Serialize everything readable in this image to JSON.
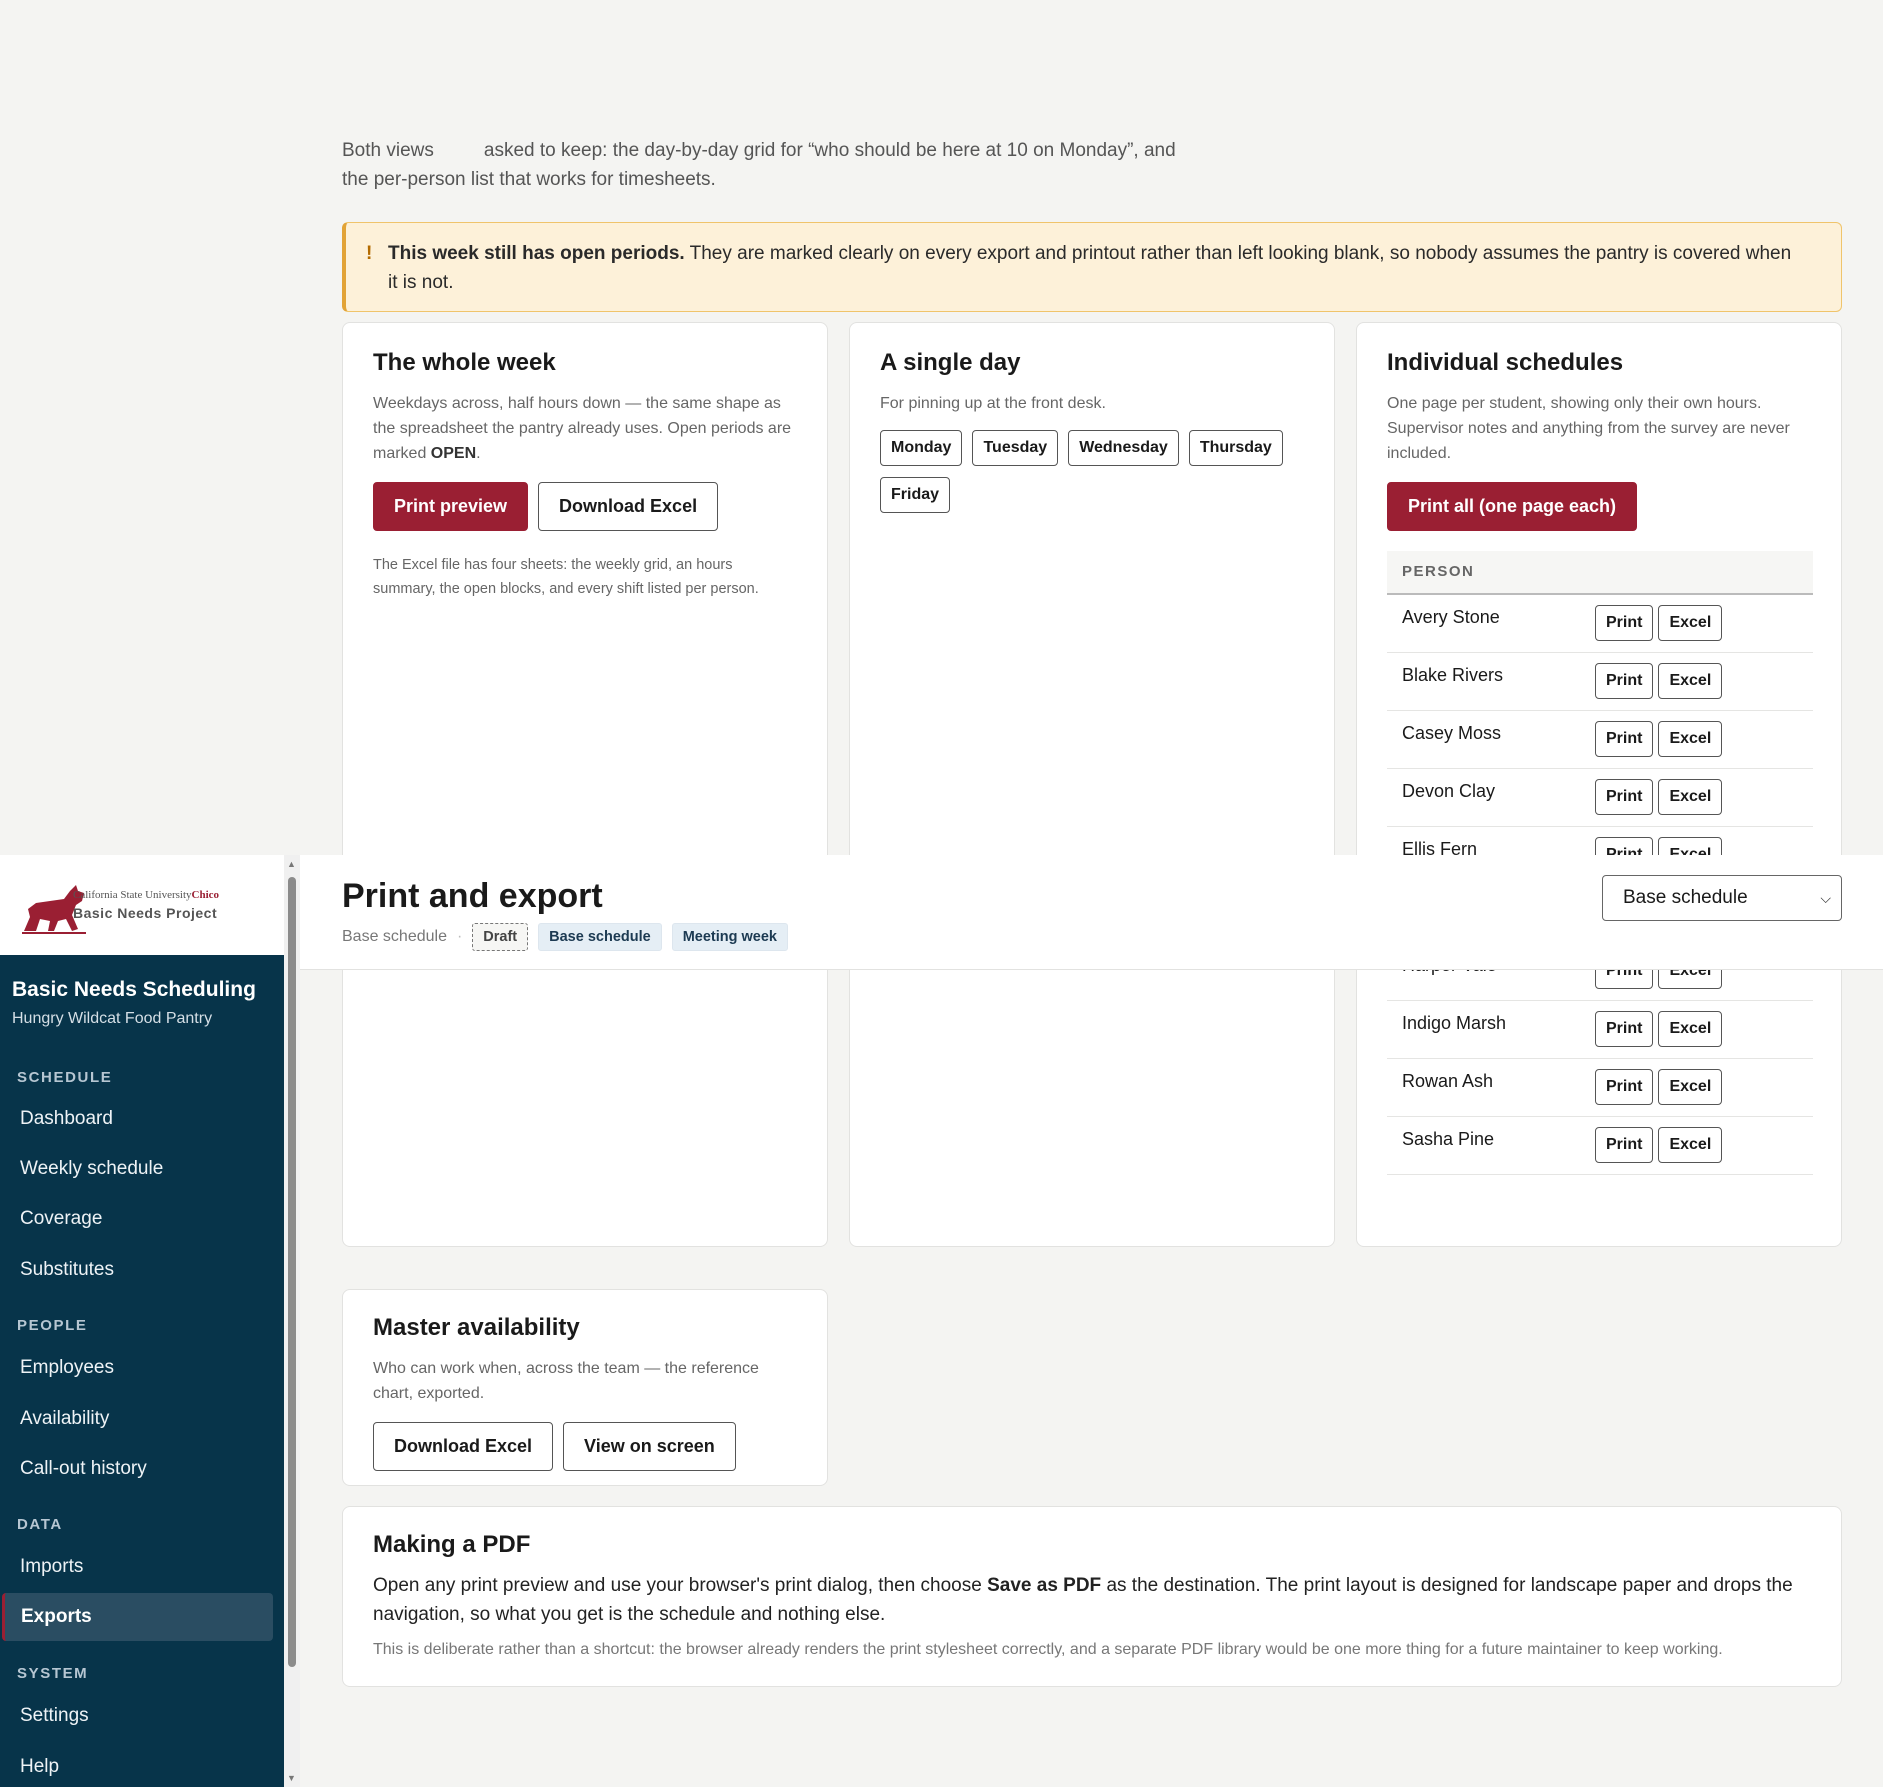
{
  "intro": {
    "part1": "Both views",
    "part2": "asked to keep: the day-by-day grid for “who should be here at 10 on Monday”, and the per-person list that works for timesheets."
  },
  "alert": {
    "icon": "!",
    "bold": "This week still has open periods.",
    "text": " They are marked clearly on every export and printout rather than left looking blank, so nobody assumes the pantry is covered when it is not."
  },
  "whole_week": {
    "title": "The whole week",
    "desc_before": "Weekdays across, half hours down — the same shape as the spreadsheet the pantry already uses. Open periods are marked ",
    "desc_bold": "OPEN",
    "desc_after": ".",
    "print_label": "Print preview",
    "excel_label": "Download Excel",
    "note": "The Excel file has four sheets: the weekly grid, an hours summary, the open blocks, and every shift listed per person."
  },
  "single_day": {
    "title": "A single day",
    "desc": "For pinning up at the front desk.",
    "days": [
      "Monday",
      "Tuesday",
      "Wednesday",
      "Thursday",
      "Friday"
    ]
  },
  "individual": {
    "title": "Individual schedules",
    "desc": "One page per student, showing only their own hours. Supervisor notes and anything from the survey are never included.",
    "print_all_label": "Print all (one page each)",
    "column_header": "PERSON",
    "print_label": "Print",
    "excel_label": "Excel",
    "people": [
      "Avery Stone",
      "Blake Rivers",
      "Casey Moss",
      "Devon Clay",
      "Ellis Fern",
      "",
      "Harper Vale",
      "Indigo Marsh",
      "Rowan Ash",
      "Sasha Pine"
    ]
  },
  "master": {
    "title": "Master availability",
    "desc": "Who can work when, across the team — the reference chart, exported.",
    "excel_label": "Download Excel",
    "view_label": "View on screen"
  },
  "pdf": {
    "title": "Making a PDF",
    "body_before": "Open any print preview and use your browser's print dialog, then choose ",
    "body_bold": "Save as PDF",
    "body_after": " as the destination. The print layout is designed for landscape paper and drops the navigation, so what you get is the schedule and nothing else.",
    "fine": "This is deliberate rather than a shortcut: the browser already renders the print stylesheet correctly, and a separate PDF library would be one more thing for a future maintainer to keep working."
  },
  "header": {
    "title": "Print and export",
    "schedule_name": "Base schedule",
    "separator": "·",
    "badges": [
      "Draft",
      "Base schedule",
      "Meeting week"
    ],
    "select_value": "Base schedule"
  },
  "logo": {
    "line1_prefix": "California State University",
    "line1_brand": "Chico",
    "line2": "Basic Needs Project"
  },
  "sidebar": {
    "app_title": "Basic Needs Scheduling",
    "app_subtitle": "Hungry Wildcat Food Pantry",
    "sections": {
      "schedule": "SCHEDULE",
      "people": "PEOPLE",
      "data": "DATA",
      "system": "SYSTEM"
    },
    "items": {
      "dashboard": "Dashboard",
      "weekly": "Weekly schedule",
      "coverage": "Coverage",
      "substitutes": "Substitutes",
      "employees": "Employees",
      "availability": "Availability",
      "callout": "Call-out history",
      "imports": "Imports",
      "exports": "Exports",
      "settings": "Settings",
      "help": "Help"
    }
  },
  "colors": {
    "brand": "#9a1f33",
    "sidebar": "#07344a",
    "alert_bg": "#fdf1d9"
  }
}
